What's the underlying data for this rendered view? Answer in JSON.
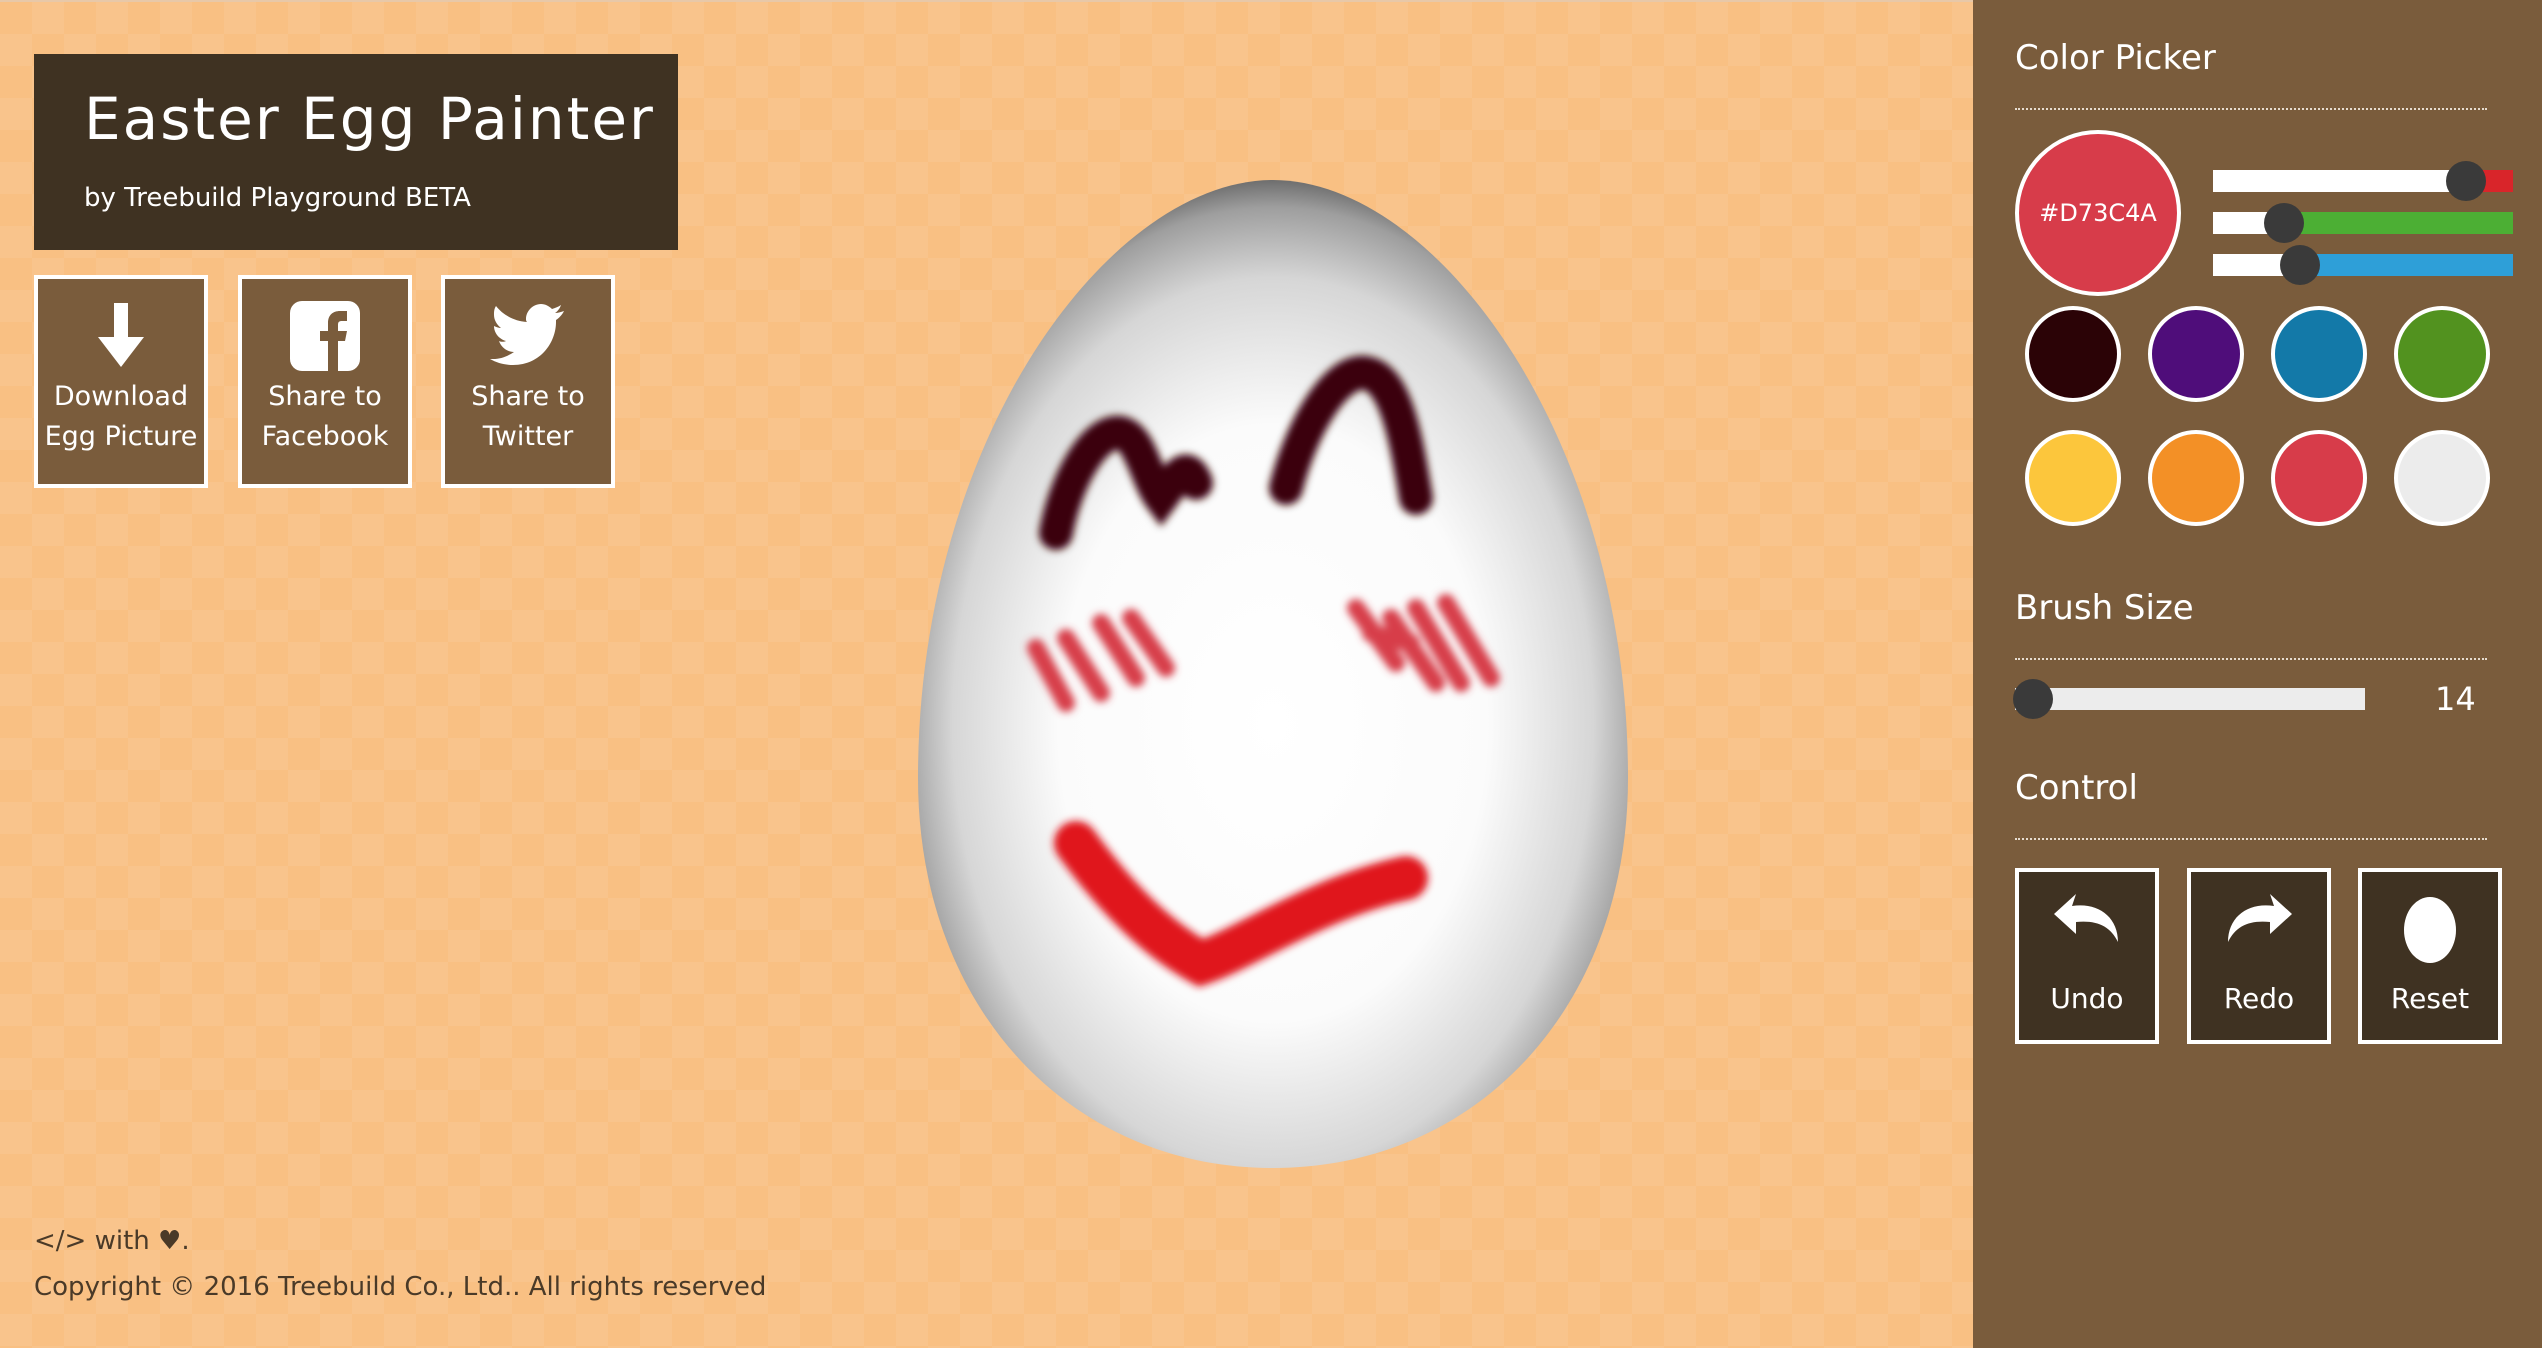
{
  "header": {
    "title": "Easter Egg Painter",
    "subtitle": "by Treebuild Playground BETA"
  },
  "share_buttons": [
    {
      "line1": "Download",
      "line2": "Egg Picture",
      "icon": "download-icon"
    },
    {
      "line1": "Share to",
      "line2": "Facebook",
      "icon": "facebook-icon"
    },
    {
      "line1": "Share to",
      "line2": "Twitter",
      "icon": "twitter-icon"
    }
  ],
  "footer": {
    "made_with": "</> with ♥.",
    "copyright": "Copyright © 2016 Treebuild Co., Ltd.. All rights reserved"
  },
  "color_picker": {
    "title": "Color Picker",
    "current_hex": "#D73C4A",
    "current_color": "#d73c4a",
    "rgb_sliders": [
      {
        "channel": "red",
        "value": 215,
        "max": 255,
        "color": "#d9252a"
      },
      {
        "channel": "green",
        "value": 60,
        "max": 255,
        "color": "#4caf34"
      },
      {
        "channel": "blue",
        "value": 74,
        "max": 255,
        "color": "#2e9fd8"
      }
    ],
    "presets": [
      "#2b0306",
      "#4f0d7a",
      "#1379a8",
      "#52921f",
      "#fcc63c",
      "#f39026",
      "#d73c4a",
      "#ececec"
    ]
  },
  "brush": {
    "title": "Brush Size",
    "value": "14"
  },
  "control": {
    "title": "Control",
    "undo": "Undo",
    "redo": "Redo",
    "reset": "Reset"
  },
  "colors": {
    "background": "#f9c083",
    "panel": "#7a5c3c",
    "dark": "#3f3222",
    "egg_paint_dark": "#3b0508",
    "egg_paint_pink": "#d73c4a",
    "egg_paint_red": "#e0121c"
  }
}
